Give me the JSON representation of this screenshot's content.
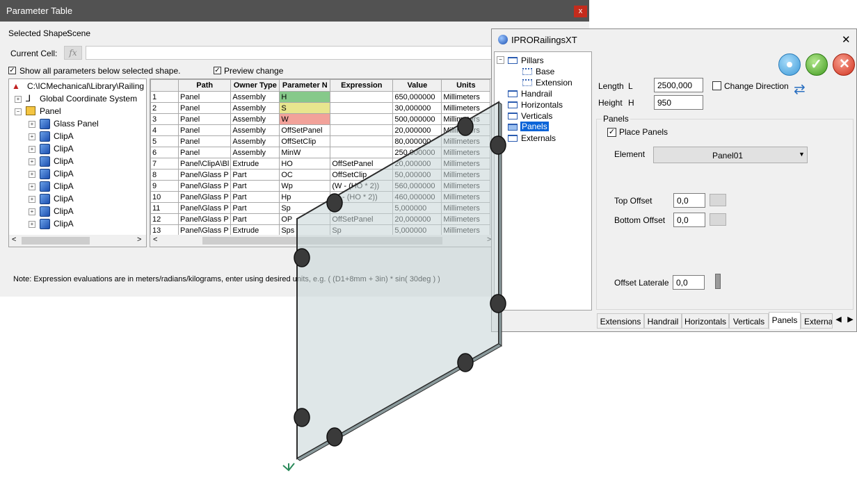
{
  "param_table": {
    "title": "Parameter Table",
    "close_glyph": "x",
    "selected_shape_label": "Selected Shape:",
    "selected_shape_value": "Scene",
    "current_cell_label": "Current Cell:",
    "fx_label": "fx",
    "show_all_label": "Show all parameters below selected shape.",
    "preview_label": "Preview change",
    "note": "Note: Expression evaluations are in meters/radians/kilograms, enter using desired units, e.g. ( (D1+8mm + 3in) * sin( 30deg ) )",
    "tree": [
      {
        "label": "C:\\ICMechanical\\Library\\Railing",
        "icon": "shape-root-icon"
      },
      {
        "label": "Global Coordinate System",
        "icon": "axes-icon"
      },
      {
        "label": "Panel",
        "icon": "assembly-icon"
      },
      {
        "label": "Glass Panel",
        "icon": "part-icon"
      },
      {
        "label": "ClipA",
        "icon": "part-icon"
      },
      {
        "label": "ClipA",
        "icon": "part-icon"
      },
      {
        "label": "ClipA",
        "icon": "part-icon"
      },
      {
        "label": "ClipA",
        "icon": "part-icon"
      },
      {
        "label": "ClipA",
        "icon": "part-icon"
      },
      {
        "label": "ClipA",
        "icon": "part-icon"
      },
      {
        "label": "ClipA",
        "icon": "part-icon"
      },
      {
        "label": "ClipA",
        "icon": "part-icon"
      }
    ],
    "grid": {
      "columns": [
        "",
        "Path",
        "Owner Type",
        "Parameter N",
        "Expression",
        "Value",
        "Units"
      ],
      "rows": [
        [
          "1",
          "Panel",
          "Assembly",
          "H",
          "",
          "650,000000",
          "Millimeters"
        ],
        [
          "2",
          "Panel",
          "Assembly",
          "S",
          "",
          "30,000000",
          "Millimeters"
        ],
        [
          "3",
          "Panel",
          "Assembly",
          "W",
          "",
          "500,000000",
          "Millimeters"
        ],
        [
          "4",
          "Panel",
          "Assembly",
          "OffSetPanel",
          "",
          "20,000000",
          "Millimeters"
        ],
        [
          "5",
          "Panel",
          "Assembly",
          "OffSetClip",
          "",
          "80,000000",
          "Millimeters"
        ],
        [
          "6",
          "Panel",
          "Assembly",
          "MinW",
          "",
          "250,000000",
          "Millimeters"
        ],
        [
          "7",
          "Panel\\ClipA\\Bl",
          "Extrude",
          "HO",
          "OffSetPanel",
          "20,000000",
          "Millimeters"
        ],
        [
          "8",
          "Panel\\Glass P",
          "Part",
          "OC",
          "OffSetClip",
          "50,000000",
          "Millimeters"
        ],
        [
          "9",
          "Panel\\Glass P",
          "Part",
          "Wp",
          "(W - (HO * 2))",
          "560,000000",
          "Millimeters"
        ],
        [
          "10",
          "Panel\\Glass P",
          "Part",
          "Hp",
          "(H - (HO * 2))",
          "460,000000",
          "Millimeters"
        ],
        [
          "11",
          "Panel\\Glass P",
          "Part",
          "Sp",
          "",
          "5,000000",
          "Millimeters"
        ],
        [
          "12",
          "Panel\\Glass P",
          "Part",
          "OP",
          "OffSetPanel",
          "20,000000",
          "Millimeters"
        ],
        [
          "13",
          "Panel\\Glass P",
          "Extrude",
          "Sps",
          "Sp",
          "5,000000",
          "Millimeters"
        ]
      ],
      "param_colors": {
        "H": "#86c98a",
        "S": "#e8e68e",
        "W": "#f2a29a"
      }
    }
  },
  "railings": {
    "title": "IPRORailingsXT",
    "close_glyph": "✕",
    "tree": [
      {
        "label": "Pillars",
        "level": 0
      },
      {
        "label": "Base",
        "level": 1
      },
      {
        "label": "Extension",
        "level": 1
      },
      {
        "label": "Handrail",
        "level": 0
      },
      {
        "label": "Horizontals",
        "level": 0
      },
      {
        "label": "Verticals",
        "level": 0
      },
      {
        "label": "Panels",
        "level": 0,
        "selected": true
      },
      {
        "label": "Externals",
        "level": 0
      }
    ],
    "length_label": "Length",
    "length_symbol": "L",
    "length_value": "2500,000",
    "height_label": "Height",
    "height_symbol": "H",
    "height_value": "950",
    "change_direction_label": "Change Direction",
    "panels_group_label": "Panels",
    "place_panels_label": "Place Panels",
    "element_label": "Element",
    "element_value": "Panel01",
    "top_offset_label": "Top Offset",
    "top_offset_value": "0,0",
    "bottom_offset_label": "Bottom Offset",
    "bottom_offset_value": "0,0",
    "offset_laterale_label": "Offset Laterale",
    "offset_laterale_value": "0,0",
    "tabs": [
      "Extensions",
      "Handrail",
      "Horizontals",
      "Verticals",
      "Panels",
      "Externa"
    ],
    "active_tab": "Panels",
    "colors": {
      "apply": "#5bb3e6",
      "ok": "#5cb82e",
      "cancel": "#e24a3a",
      "selection": "#0a64d8"
    }
  }
}
